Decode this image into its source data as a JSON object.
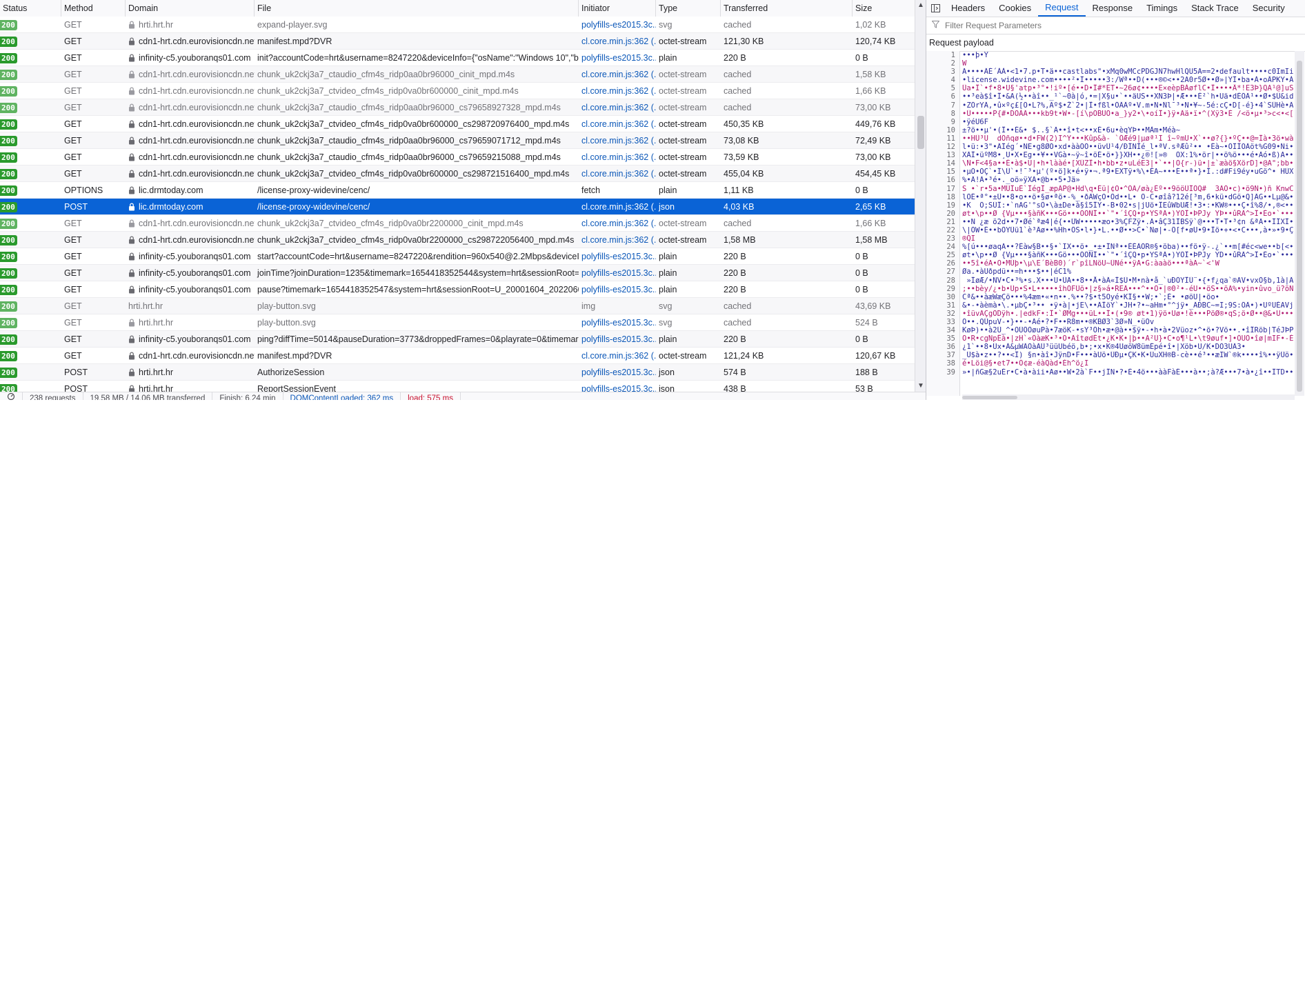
{
  "columns": {
    "status": "Status",
    "method": "Method",
    "domain": "Domain",
    "file": "File",
    "initiator": "Initiator",
    "type": "Type",
    "transferred": "Transferred",
    "size": "Size"
  },
  "rows": [
    {
      "status": "200",
      "method": "GET",
      "domain": "hrti.hrt.hr",
      "file": "expand-player.svg",
      "initiator": "polyfills-es2015.3c...",
      "type": "svg",
      "transferred": "cached",
      "size": "1,02 KB",
      "cached": true,
      "lock": true
    },
    {
      "status": "200",
      "method": "GET",
      "domain": "cdn1-hrt.cdn.eurovisioncdn.net",
      "file": "manifest.mpd?DVR",
      "initiator": "cl.core.min.js:362 (...",
      "type": "octet-stream",
      "transferred": "121,30 KB",
      "size": "120,74 KB",
      "cached": false,
      "lock": true
    },
    {
      "status": "200",
      "method": "GET",
      "domain": "infinity-c5.youboranqs01.com",
      "file": "init?accountCode=hrt&username=8247220&deviceInfo={\"osName\":\"Windows 10\",\"browse",
      "initiator": "polyfills-es2015.3c...",
      "type": "plain",
      "transferred": "220 B",
      "size": "0 B",
      "cached": false,
      "lock": true
    },
    {
      "status": "200",
      "method": "GET",
      "domain": "cdn1-hrt.cdn.eurovisioncdn.net",
      "file": "chunk_uk2ckj3a7_ctaudio_cfm4s_ridp0aa0br96000_cinit_mpd.m4s",
      "initiator": "cl.core.min.js:362 (...",
      "type": "octet-stream",
      "transferred": "cached",
      "size": "1,58 KB",
      "cached": true,
      "lock": true
    },
    {
      "status": "200",
      "method": "GET",
      "domain": "cdn1-hrt.cdn.eurovisioncdn.net",
      "file": "chunk_uk2ckj3a7_ctvideo_cfm4s_ridp0va0br600000_cinit_mpd.m4s",
      "initiator": "cl.core.min.js:362 (...",
      "type": "octet-stream",
      "transferred": "cached",
      "size": "1,66 KB",
      "cached": true,
      "lock": true
    },
    {
      "status": "200",
      "method": "GET",
      "domain": "cdn1-hrt.cdn.eurovisioncdn.net",
      "file": "chunk_uk2ckj3a7_ctaudio_cfm4s_ridp0aa0br96000_cs79658927328_mpd.m4s",
      "initiator": "cl.core.min.js:362 (...",
      "type": "octet-stream",
      "transferred": "cached",
      "size": "73,00 KB",
      "cached": true,
      "lock": true
    },
    {
      "status": "200",
      "method": "GET",
      "domain": "cdn1-hrt.cdn.eurovisioncdn.net",
      "file": "chunk_uk2ckj3a7_ctvideo_cfm4s_ridp0va0br600000_cs298720976400_mpd.m4s",
      "initiator": "cl.core.min.js:362 (...",
      "type": "octet-stream",
      "transferred": "450,35 KB",
      "size": "449,76 KB",
      "cached": false,
      "lock": true
    },
    {
      "status": "200",
      "method": "GET",
      "domain": "cdn1-hrt.cdn.eurovisioncdn.net",
      "file": "chunk_uk2ckj3a7_ctaudio_cfm4s_ridp0aa0br96000_cs79659071712_mpd.m4s",
      "initiator": "cl.core.min.js:362 (...",
      "type": "octet-stream",
      "transferred": "73,08 KB",
      "size": "72,49 KB",
      "cached": false,
      "lock": true
    },
    {
      "status": "200",
      "method": "GET",
      "domain": "cdn1-hrt.cdn.eurovisioncdn.net",
      "file": "chunk_uk2ckj3a7_ctaudio_cfm4s_ridp0aa0br96000_cs79659215088_mpd.m4s",
      "initiator": "cl.core.min.js:362 (...",
      "type": "octet-stream",
      "transferred": "73,59 KB",
      "size": "73,00 KB",
      "cached": false,
      "lock": true
    },
    {
      "status": "200",
      "method": "GET",
      "domain": "cdn1-hrt.cdn.eurovisioncdn.net",
      "file": "chunk_uk2ckj3a7_ctvideo_cfm4s_ridp0va0br600000_cs298721516400_mpd.m4s",
      "initiator": "cl.core.min.js:362 (...",
      "type": "octet-stream",
      "transferred": "455,04 KB",
      "size": "454,45 KB",
      "cached": false,
      "lock": true
    },
    {
      "status": "200",
      "method": "OPTIONS",
      "domain": "lic.drmtoday.com",
      "file": "/license-proxy-widevine/cenc/",
      "initiator": "fetch",
      "type": "plain",
      "transferred": "1,11 KB",
      "size": "0 B",
      "cached": false,
      "lock": true
    },
    {
      "status": "200",
      "method": "POST",
      "domain": "lic.drmtoday.com",
      "file": "/license-proxy-widevine/cenc/",
      "initiator": "cl.core.min.js:362 (...",
      "type": "json",
      "transferred": "4,03 KB",
      "size": "2,65 KB",
      "cached": false,
      "lock": true,
      "selected": true
    },
    {
      "status": "200",
      "method": "GET",
      "domain": "cdn1-hrt.cdn.eurovisioncdn.net",
      "file": "chunk_uk2ckj3a7_ctvideo_cfm4s_ridp0va0br2200000_cinit_mpd.m4s",
      "initiator": "cl.core.min.js:362 (...",
      "type": "octet-stream",
      "transferred": "cached",
      "size": "1,66 KB",
      "cached": true,
      "lock": true
    },
    {
      "status": "200",
      "method": "GET",
      "domain": "cdn1-hrt.cdn.eurovisioncdn.net",
      "file": "chunk_uk2ckj3a7_ctvideo_cfm4s_ridp0va0br2200000_cs298722056400_mpd.m4s",
      "initiator": "cl.core.min.js:362 (...",
      "type": "octet-stream",
      "transferred": "1,58 MB",
      "size": "1,58 MB",
      "cached": false,
      "lock": true
    },
    {
      "status": "200",
      "method": "GET",
      "domain": "infinity-c5.youboranqs01.com",
      "file": "start?accountCode=hrt&username=8247220&rendition=960x540@2.2Mbps&deviceInfo={",
      "initiator": "polyfills-es2015.3c...",
      "type": "plain",
      "transferred": "220 B",
      "size": "0 B",
      "cached": false,
      "lock": true
    },
    {
      "status": "200",
      "method": "GET",
      "domain": "infinity-c5.youboranqs01.com",
      "file": "joinTime?joinDuration=1235&timemark=1654418352544&system=hrt&sessionRoot=U_200",
      "initiator": "polyfills-es2015.3c...",
      "type": "plain",
      "transferred": "220 B",
      "size": "0 B",
      "cached": false,
      "lock": true
    },
    {
      "status": "200",
      "method": "GET",
      "domain": "infinity-c5.youboranqs01.com",
      "file": "pause?timemark=1654418352547&system=hrt&sessionRoot=U_20001604_20220605_216mr",
      "initiator": "polyfills-es2015.3c...",
      "type": "plain",
      "transferred": "220 B",
      "size": "0 B",
      "cached": false,
      "lock": true
    },
    {
      "status": "200",
      "method": "GET",
      "domain": "hrti.hrt.hr",
      "file": "play-button.svg",
      "initiator": "img",
      "type": "svg",
      "transferred": "cached",
      "size": "43,69 KB",
      "cached": true,
      "lock": false
    },
    {
      "status": "200",
      "method": "GET",
      "domain": "hrti.hrt.hr",
      "file": "play-button.svg",
      "initiator": "polyfills-es2015.3c...",
      "type": "svg",
      "transferred": "cached",
      "size": "524 B",
      "cached": true,
      "lock": true
    },
    {
      "status": "200",
      "method": "GET",
      "domain": "infinity-c5.youboranqs01.com",
      "file": "ping?diffTime=5014&pauseDuration=3773&droppedFrames=0&playrate=0&timemark=16",
      "initiator": "polyfills-es2015.3c...",
      "type": "plain",
      "transferred": "220 B",
      "size": "0 B",
      "cached": false,
      "lock": true
    },
    {
      "status": "200",
      "method": "GET",
      "domain": "cdn1-hrt.cdn.eurovisioncdn.net",
      "file": "manifest.mpd?DVR",
      "initiator": "cl.core.min.js:362 (...",
      "type": "octet-stream",
      "transferred": "121,24 KB",
      "size": "120,67 KB",
      "cached": false,
      "lock": true
    },
    {
      "status": "200",
      "method": "POST",
      "domain": "hrti.hrt.hr",
      "file": "AuthorizeSession",
      "initiator": "polyfills-es2015.3c...",
      "type": "json",
      "transferred": "574 B",
      "size": "188 B",
      "cached": false,
      "lock": true
    },
    {
      "status": "200",
      "method": "POST",
      "domain": "hrti.hrt.hr",
      "file": "ReportSessionEvent",
      "initiator": "polyfills-es2015.3c...",
      "type": "json",
      "transferred": "438 B",
      "size": "53 B",
      "cached": false,
      "lock": true
    }
  ],
  "statusbar": {
    "requests": "238 requests",
    "transferred": "19,58 MB / 14,06 MB transferred",
    "finish": "Finish: 6,24 min",
    "dom": "DOMContentLoaded: 362 ms",
    "load": "load: 575 ms"
  },
  "details": {
    "tabs": [
      "Headers",
      "Cookies",
      "Request",
      "Response",
      "Timings",
      "Stack Trace",
      "Security"
    ],
    "active_tab": "Request",
    "filter_placeholder": "Filter Request Parameters",
    "section_title": "Request payload",
    "payload_lines": [
      "•••þ•Y",
      "W",
      "A••••ÄÉ´ÀÀ•<1•7.p•T•ä••castlabs\"•xMq0wMCcPDGJN7hwHlQU5A==2•default••••c0ImIi3uxmb",
      "•license.widevine.com••••²•Î•••••3:/Wª••D(•••®©<••2A0r5Ø••Ø»|YÎ•ba•À•oÂPKY•À•ÎD•ü#",
      "Ûa•Î`•f•8•U§'atp•³°•!iº•[é••D•Î#*ET•~26ø¢••••E×eèpBÀøflC•Î••••Â*!E3Þ}QA¹@]uSaPä••ÉU",
      "••³eà$î•Î•&A(½••àî••_¹`~0à|ó,•=|X§u•`••äUS••XN3Þ|•Æ•••È²`h•Uä•dÉÖÄ¹••Ø•$Û&idl7É¢Õ",
      "•ZÖrYÄ,•û×ºç£[Õ•L?%,Äº$•Ž`2•|Î•fßl•ÖÄÄº•V.m•N•Ñl¯³•N•¥~-5é:cÇ•D[-é}•4`SÛHè•Äç•••d•",
      "•Ù•••••P{#•DÖÀÄ•••kb9t•W•-[í\\pÖBUÖ•a_}y2•\\•oíÎ•}ÿ•Ää•ï•^(Xÿ3•É /<ö•µ•³>c<•<[ñ",
      "•ÿéU6F",
      "±?ö••µ'•(Î••É&• $..§`Ã••î•t<••xÉ•6u•èqYÞ••MÀm•Méà~",
      "••HÛ³U  dÖñqø••d•FW(2)I^Y•••Kûp&à- `ÓÆé9|µøª¹I î~ºmU•X`••ø?{}•ºÇ••@=Îà•3ö•wàÑéû",
      "l•ü:•3\"•ÄÎég´•NE•g8ØÓ•xd•ààÖÖ••üvÛ¹4/ÐÎNÎé_l•ªV.sªÆû²•• •Éà~•ÖÎÎOÄöt%G09•Ñi•d•Î",
      "XÄÎ•üºM8•¸U•X•Eg••¥••VGà•~ÿ~î•öÉ•ö•}}XH••¿®![»®  ÖX:1%•ör|••ö%ö•••é•Ãó•ß)A•••••",
      "\\Ñ•F<4§a••É•à$•Ü|•h•lààé•[XÛZÎ•h•bb•z•uLéE3|•`••|O{r-)ü•|±`æàö§XörD]•@A\";bb•¹07ÄÀ",
      "•µÖ•OÇ`•Î\\Ü`•!¯³•µ'(º•ö]k•é•ÿ•¬.ª9•EXTÿ•%\\•ÉA~•••É••ª•}•Î.:d#Fi9éy•uGö^• HÜXéXN•ÉüÜ",
      "%•Ä!Ä•³é•._oö»ÿXÄ•@b••5•Jä»",
      "S •`r•5a•MÜÎuÉ`ÎégÎ_æpÄP@•Hd\\q•Éü|¢O•^ÕÄ/øà¿Éº••9ööÜÎÖQ#  3AÖ•c)•ö9Ñ•)ñ KnwCÉ•ö_",
      "lÖÉ•ª°•±Ü••8•o••ö•§ø•ªö•-%_•ðÄWçO•Öd••L• Ö-C•øîâ?12é[³m,6•kü•dGö•Q]ÄG••Lµ@&••|ÎR",
      "•K  Ö;SÜÎ:•`nAG'°sÖ•\\à±De•à§î5ÎY•-B•02•s|jUö•ÎEûWbUÆ!•3•:•KW®•••Ç•î%8/•,®<••E1•æ",
      "øt•\\p••Ø {Vµ•••§àñK•••Gö•••ÖÖÑÎ••`\"•´îÇQ•p•YSªÄ•)YÖÎ•ÞPJy YÞ••ûRÄ^>Î•Éo•`•••év^yT•",
      "••N ¿æ ö2d••7•Øé`ªæ4|é{••ÜW•••••æo•3%ÇFZÿ•.Ä•âÇ31ÎBSÿ`@•••T•T•³¢n &ªÄ••ÎÎXÎ••(öÄ••",
      "\\|ÖW•É••bÖYÜü1`è³Äø••%Hh•ÖS•l•}•L.••Ø••>C•`Nø|•-Ö[f•øU•9•Îö•+•<•C•••,à•»•9•Ç•D;",
      "®QI",
      "%[ú•••øaqA••?Éàw§B••§•`IX••ö•_•±•ÎNª••ÉÉÄÖR®§•öba)••fö•ÿ-.¿`••m[#éc<we••b[<•é•=",
      "øt•\\p••Ø {Vµ•••§àñK•••Gö•••ÖÖÑÎ••`\"•´îÇQ•p•YSªÄ•)YÖÎ•ÞPJy YD••ûRÄ^>Î•Éo•`•••év^yT",
      "••5î•éA•O•MÜþ•\\µ\\E´BèB0)´r`pîLNöU~ÜNé••ÿA•G:àaàö•••ªàA~`<'W",
      "Øa.•àUðpdü••=h•••$••|éC1%",
      " »ÎøÆ/•NV•C•³%•s.X•••U•ÛÄ••8••Å•àÄ«Î$Ü•M•nà•å_`uÐÖYÎÜ¨•{•f¿qa`®AV•vxÖ§b,1à|Ä9àXÉ•",
      ";••bèy/¿•b•Üp•S•L•••••îhÖFÜö•|z§»á•REÄ•••^••Ö•|®0²•-éU••öS••öA%•yin•ûvo_ü?öÑM•Î•",
      "Cª&••àæWæÇö•••%4æm•«•n••.%••?$•t5Oyé•KÎ§••W;•`;É• •øöU|•öo•",
      "&•-•àèmà•\\.•µbÇ•³•• •ÿ•à|•jE\\••ÄÎöY`•JH•?•~aHm•°^jÿ•_ÄÐBC~=I;9S:ÖÄ•)•UºUÉAVj••³•••ü",
      "•îüvAÇgÖDÿh•.|edkF•:Î•`ØMg•••üL••Î•(•9® øt•1)ÿö•Uø•!è•••PöØ®•qS;ö•Ø••@&•U•••jYÆ•,",
      "Ö••.QÛpuV-•}••-•Äé•?•F••R8m••®KBØ3`3Ø»Ñ_•üÖv",
      "KøÞ)••à2Ü_^•ÖÜÖÖøuPà•7æöK-•sY³Öh•æ•@à••$ÿ•-•h•à•2Vüoz•^•ö•?Vö••.•îÎRöb|TéJÞPtàdÄhéé",
      "O•R•cgNpÊà•|zH`«ÖàæK•³•O•ÄîtødÉt•¿K•K•|þ••A²U}•C•o¶¹L•\\t9øuf•]•ÖUÖ•îø|mIF•-ÉÖÖG@",
      "¿1`••8•Üx•Ä&µWÄÖàÄÜ³üüUbéö,b•;•x•K®4UøöW8ümÉpé•î•|Xöb•U/K•DÖ3UÄ3•",
      "_Ü$à•z••?••<Î) §n•àî•JÿnD•F•••àUö•ÜÐµ•ÇK•K•ÜuXH®B-cè••é³••æIW`®k••••î%••ÿÜö•ømy•",
      "é•Löi@§•et7••Ö¢æ-éàQàd•Éh^ö¿I",
      "»•|ñGæ§2uÉr•C•à•àii•Aø••W•2à`F••jÎN•?•É•4ö•••ààFàÉ•••à••;à?Æ•••7•à•¿î••ÎTD••ØÖH"
    ]
  }
}
